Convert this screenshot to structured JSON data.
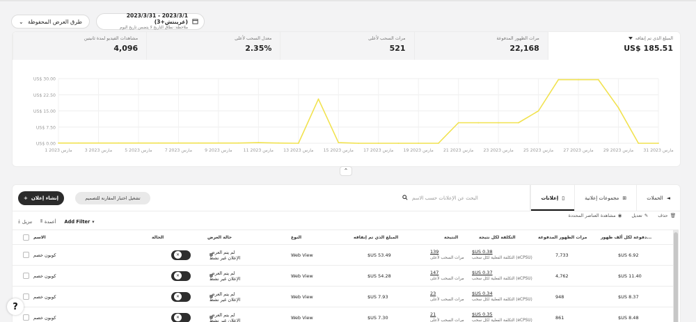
{
  "filters": {
    "saved_view_label": "طرق العرض المحفوظة",
    "date_range": "2023/3/1 - 2023/3/31 (غرينتش+3)",
    "date_note": "ملاحظة: نطاق التاريخ لا يتضمن تاريخ اليوم"
  },
  "metrics": [
    {
      "label": "المبلغ الذي تم إنفاقه",
      "value": "US$ 185.51",
      "active": true
    },
    {
      "label": "مرات الظهور المدفوعة",
      "value": "22,168"
    },
    {
      "label": "مرات السحب لأعلى",
      "value": "521"
    },
    {
      "label": "معدل السحب لأعلى",
      "value": "2.35%"
    },
    {
      "label": "مشاهدات الفيديو لمدة ثانيتين",
      "value": "4,096"
    }
  ],
  "chart_data": {
    "type": "line",
    "y_ticks": [
      "US$ 0.00",
      "US$ 7.50",
      "US$ 15.00",
      "US$ 22.50",
      "US$ 30.00"
    ],
    "ylim": [
      0,
      30
    ],
    "x_ticks": [
      "1 مارس 2023",
      "3 مارس 2023",
      "5 مارس 2023",
      "7 مارس 2023",
      "9 مارس 2023",
      "11 مارس 2023",
      "13 مارس 2023",
      "15 مارس 2023",
      "17 مارس 2023",
      "19 مارس 2023",
      "21 مارس 2023",
      "23 مارس 2023",
      "25 مارس 2023",
      "27 مارس 2023",
      "29 مارس 2023",
      "31 مارس 2023"
    ],
    "series": [
      {
        "color": "#f1e24f",
        "x": [
          1,
          2,
          3,
          4,
          5,
          6,
          7,
          8,
          9,
          10,
          11,
          12,
          13,
          14,
          15,
          16,
          17,
          18,
          19,
          20,
          21,
          22,
          23,
          24,
          25,
          26,
          27,
          28,
          29,
          30,
          31
        ],
        "values": [
          0.1,
          0.1,
          0.1,
          0.1,
          0.1,
          0.1,
          0.1,
          0.1,
          0.1,
          0.1,
          0.3,
          0.1,
          0,
          20.5,
          0.3,
          0,
          0,
          0,
          0,
          0,
          9.5,
          9.5,
          9.5,
          9.5,
          15,
          29.5,
          29.5,
          29.5,
          16.5,
          0,
          0
        ]
      }
    ],
    "grid": true
  },
  "collapse_icon": "chevron-up-icon",
  "table_panel": {
    "create_button": "إنشاء إعلان",
    "compare_button": "تشغيل اختبار المقارنة للتصميم",
    "search_placeholder": "البحث عن الإعلانات حسب الاسم",
    "tabs": [
      {
        "label": "الحملات",
        "icon": "megaphone-icon"
      },
      {
        "label": "مجموعات إعلانية",
        "icon": "grid-icon"
      },
      {
        "label": "إعلانات",
        "icon": "phone-icon",
        "active": true
      }
    ],
    "actions": {
      "view_selected": "مشاهدة العناصر المحددة",
      "edit": "تعديل",
      "delete": "حذف"
    },
    "tools": {
      "download": "تنزيل",
      "columns": "أعمدة",
      "add_filter": "Add Filter"
    },
    "headers": {
      "name": "الاسم",
      "state": "الحالة",
      "display_status": "حالة العرض",
      "type": "النوع",
      "spend": "المبلغ الذي تم إنفاقه",
      "result": "النتيجة",
      "cost_per_result": "التكلفة لكل نتيجة",
      "impressions": "مرات الظهور المدفوعة",
      "ecpm": "...دفوعة لكل ألف ظهور"
    },
    "rows": [
      {
        "name": "كوبون خصم",
        "status1": "لم يتم العرض",
        "status2": "الإعلان غير نشط",
        "type": "Web View",
        "spend": "53.49 US$",
        "result": "139",
        "result_sub": "مرات السحب لأعلى",
        "cpr": "0.38 US$",
        "cpr_sub": "(eCPSU) التكلفة الفعلية لكل سحب",
        "impressions": "7,733",
        "ecpm": "6.92 US$"
      },
      {
        "name": "كوبون خصم",
        "status1": "لم يتم العرض",
        "status2": "الإعلان غير نشط",
        "type": "Web View",
        "spend": "54.28 US$",
        "result": "147",
        "result_sub": "مرات السحب لأعلى",
        "cpr": "0.37 US$",
        "cpr_sub": "(eCPSU) التكلفة الفعلية لكل سحب",
        "impressions": "4,762",
        "ecpm": "11.40 US$"
      },
      {
        "name": "كوبون خصم",
        "status1": "لم يتم العرض",
        "status2": "الإعلان غير نشط",
        "type": "Web View",
        "spend": "7.93 US$",
        "result": "23",
        "result_sub": "مرات السحب لأعلى",
        "cpr": "0.34 US$",
        "cpr_sub": "(eCPSU) التكلفة الفعلية لكل سحب",
        "impressions": "948",
        "ecpm": "8.37 US$"
      },
      {
        "name": "كوبون خصم",
        "status1": "لم يتم العرض",
        "status2": "الإعلان غير نشط",
        "type": "Web View",
        "spend": "7.30 US$",
        "result": "21",
        "result_sub": "مرات السحب لأعلى",
        "cpr": "0.35 US$",
        "cpr_sub": "(eCPSU) التكلفة الفعلية لكل سحب",
        "impressions": "861",
        "ecpm": "8.48 US$"
      }
    ]
  },
  "help_label": "?"
}
